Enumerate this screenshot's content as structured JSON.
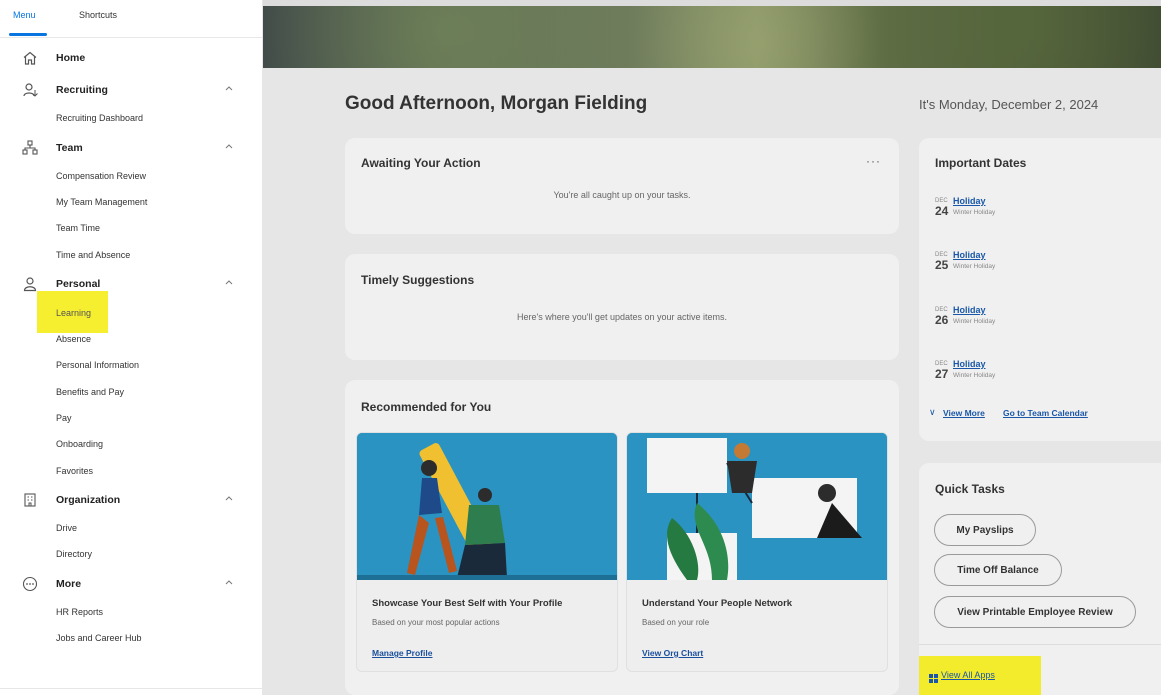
{
  "sidebar": {
    "tabs": [
      {
        "label": "Menu",
        "active": true
      },
      {
        "label": "Shortcuts",
        "active": false
      }
    ],
    "sections": [
      {
        "label": "Home",
        "icon": "home-icon",
        "items": []
      },
      {
        "label": "Recruiting",
        "icon": "recruiting-icon",
        "items": [
          "Recruiting Dashboard"
        ]
      },
      {
        "label": "Team",
        "icon": "team-icon",
        "items": [
          "Compensation Review",
          "My Team Management",
          "Team Time",
          "Time and Absence"
        ]
      },
      {
        "label": "Personal",
        "icon": "person-icon",
        "items": [
          "Learning",
          "Absence",
          "Personal Information",
          "Benefits and Pay",
          "Pay",
          "Onboarding",
          "Favorites"
        ]
      },
      {
        "label": "Organization",
        "icon": "building-icon",
        "items": [
          "Drive",
          "Directory"
        ]
      },
      {
        "label": "More",
        "icon": "more-icon",
        "items": [
          "HR Reports",
          "Jobs and Career Hub"
        ]
      }
    ]
  },
  "main": {
    "greeting": "Good Afternoon, Morgan Fielding",
    "date_line": "It's Monday, December 2, 2024",
    "awaiting": {
      "title": "Awaiting Your Action",
      "message": "You're all caught up on your tasks."
    },
    "timely": {
      "title": "Timely Suggestions",
      "message": "Here's where you'll get updates on your active items."
    },
    "recommended": {
      "title": "Recommended for You",
      "items": [
        {
          "title": "Showcase Your Best Self with Your Profile",
          "subtitle": "Based on your most popular actions",
          "link": "Manage Profile"
        },
        {
          "title": "Understand Your People Network",
          "subtitle": "Based on your role",
          "link": "View Org Chart"
        }
      ]
    },
    "important_dates": {
      "title": "Important Dates",
      "items": [
        {
          "month": "DEC",
          "day": "24",
          "name": "Holiday",
          "desc": "Winter Holiday"
        },
        {
          "month": "DEC",
          "day": "25",
          "name": "Holiday",
          "desc": "Winter Holiday"
        },
        {
          "month": "DEC",
          "day": "26",
          "name": "Holiday",
          "desc": "Winter Holiday"
        },
        {
          "month": "DEC",
          "day": "27",
          "name": "Holiday",
          "desc": "Winter Holiday"
        }
      ],
      "view_more": "View More",
      "team_calendar": "Go to Team Calendar"
    },
    "quick_tasks": {
      "title": "Quick Tasks",
      "buttons": [
        "My Payslips",
        "Time Off Balance",
        "View Printable Employee Review"
      ],
      "view_all": "View All Apps"
    }
  },
  "colors": {
    "accent": "#0875e1",
    "highlight": "#f5ef2f",
    "link": "#1a57a8"
  }
}
